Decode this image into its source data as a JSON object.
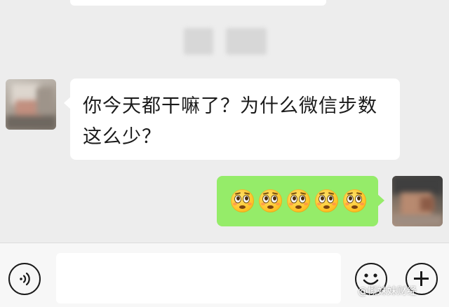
{
  "messages": [
    {
      "direction": "received",
      "text": "你今天都干嘛了？为什么微信步数这么少？"
    },
    {
      "direction": "sent",
      "emojis": [
        "pleading-face",
        "pleading-face",
        "pleading-face",
        "pleading-face",
        "pleading-face"
      ]
    }
  ],
  "input": {
    "value": "",
    "placeholder": ""
  },
  "toolbar": {
    "voice_icon": "voice-waves-icon",
    "emoji_icon": "smiley-face-icon",
    "plus_icon": "plus-icon"
  },
  "watermark": "@慨妹妹财经",
  "colors": {
    "chat_background": "#ededed",
    "received_bubble": "#ffffff",
    "sent_bubble": "#95ec69",
    "input_bar": "#f7f7f7"
  }
}
